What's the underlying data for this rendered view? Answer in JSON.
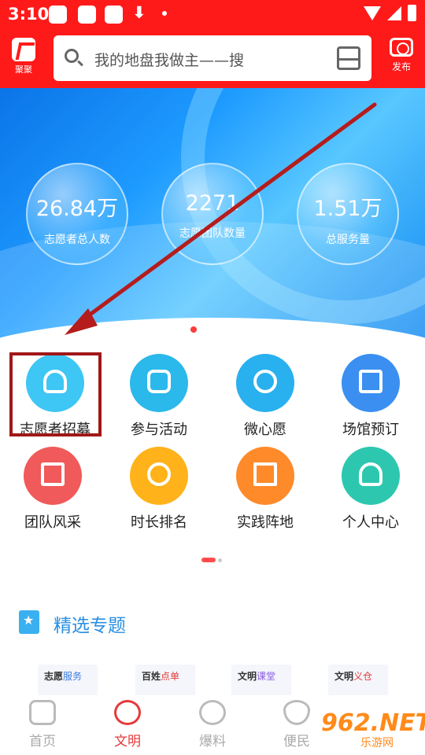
{
  "status_bar": {
    "time": "3:10",
    "download_glyph": "⬇"
  },
  "header": {
    "logo_label": "聚聚",
    "search_placeholder": "我的地盘我做主——搜",
    "publish_label": "发布"
  },
  "banner": {
    "stats": [
      {
        "value": "26.84万",
        "caption": "志愿者总人数"
      },
      {
        "value": "2271",
        "caption": "志愿团队数量"
      },
      {
        "value": "1.51万",
        "caption": "总服务量"
      }
    ],
    "page_count": 4,
    "active_page": 1
  },
  "grid": {
    "items": [
      {
        "label": "志愿者招募",
        "icon": "cap-icon",
        "color": "#3ec6f5"
      },
      {
        "label": "参与活动",
        "icon": "activity-icon",
        "color": "#2bb8ea"
      },
      {
        "label": "微心愿",
        "icon": "heart-hand-icon",
        "color": "#28b0ef"
      },
      {
        "label": "场馆预订",
        "icon": "store-icon",
        "color": "#3a8ff0"
      },
      {
        "label": "团队风采",
        "icon": "photo-icon",
        "color": "#f05a5a"
      },
      {
        "label": "时长排名",
        "icon": "medal-icon",
        "color": "#ffb21a"
      },
      {
        "label": "实践阵地",
        "icon": "flag-icon",
        "color": "#ff8a2a"
      },
      {
        "label": "个人中心",
        "icon": "user-icon",
        "color": "#2dc7b0"
      }
    ]
  },
  "section": {
    "title": "精选专题"
  },
  "cards": [
    {
      "prefix": "志愿",
      "suffix": "服务"
    },
    {
      "prefix": "百姓",
      "suffix": "点单"
    },
    {
      "prefix": "文明",
      "suffix": "课堂"
    },
    {
      "prefix": "文明",
      "suffix": "义仓"
    }
  ],
  "bottom_nav": {
    "items": [
      {
        "label": "首页",
        "icon": "home-icon",
        "active": false
      },
      {
        "label": "文明",
        "icon": "flower-icon",
        "active": true
      },
      {
        "label": "爆料",
        "icon": "fire-icon",
        "active": false
      },
      {
        "label": "便民",
        "icon": "heart-icon",
        "active": false
      }
    ]
  },
  "watermark": {
    "main": "962.NET",
    "sub": "乐游网"
  },
  "colors": {
    "primary_red": "#ff1a1a",
    "annotation_red": "#a01818"
  }
}
